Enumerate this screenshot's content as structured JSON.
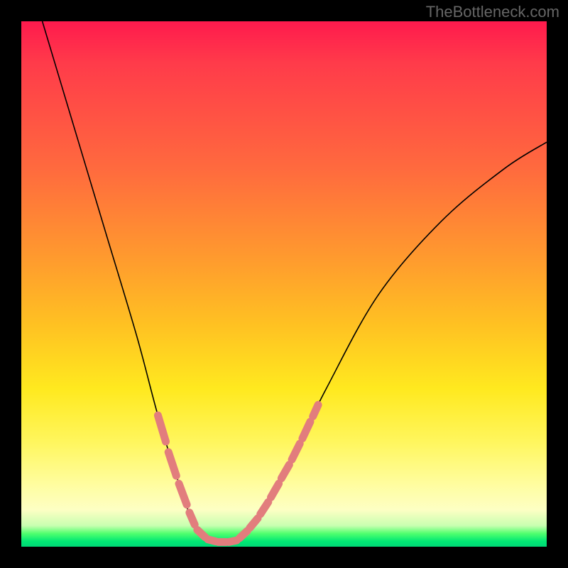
{
  "watermark": "TheBottleneck.com",
  "chart_data": {
    "type": "line",
    "title": "",
    "xlabel": "",
    "ylabel": "",
    "xlim": [
      0,
      100
    ],
    "ylim": [
      0,
      100
    ],
    "curve": {
      "name": "bottleneck-curve",
      "points": [
        {
          "x": 4,
          "y": 100
        },
        {
          "x": 10,
          "y": 80
        },
        {
          "x": 16,
          "y": 60
        },
        {
          "x": 22,
          "y": 40
        },
        {
          "x": 26,
          "y": 25
        },
        {
          "x": 30,
          "y": 12
        },
        {
          "x": 33,
          "y": 4
        },
        {
          "x": 36,
          "y": 1
        },
        {
          "x": 40,
          "y": 1
        },
        {
          "x": 44,
          "y": 4
        },
        {
          "x": 50,
          "y": 14
        },
        {
          "x": 58,
          "y": 30
        },
        {
          "x": 68,
          "y": 48
        },
        {
          "x": 80,
          "y": 62
        },
        {
          "x": 92,
          "y": 72
        },
        {
          "x": 100,
          "y": 77
        }
      ]
    },
    "highlight_segments": [
      {
        "x0": 26,
        "y0": 25,
        "x1": 27.5,
        "y1": 20
      },
      {
        "x0": 28,
        "y0": 18,
        "x1": 29.5,
        "y1": 13.5
      },
      {
        "x0": 30,
        "y0": 12,
        "x1": 31.5,
        "y1": 8
      },
      {
        "x0": 32,
        "y0": 6.5,
        "x1": 33,
        "y1": 4.2
      },
      {
        "x0": 33.5,
        "y0": 3.2,
        "x1": 35,
        "y1": 1.8
      },
      {
        "x0": 35.5,
        "y0": 1.4,
        "x1": 37,
        "y1": 1
      },
      {
        "x0": 37.5,
        "y0": 0.9,
        "x1": 39,
        "y1": 0.9
      },
      {
        "x0": 39.5,
        "y0": 0.9,
        "x1": 41,
        "y1": 1.2
      },
      {
        "x0": 41.5,
        "y0": 1.6,
        "x1": 43,
        "y1": 3
      },
      {
        "x0": 43.5,
        "y0": 3.6,
        "x1": 45,
        "y1": 5.4
      },
      {
        "x0": 45.5,
        "y0": 6.2,
        "x1": 47,
        "y1": 8.5
      },
      {
        "x0": 47.5,
        "y0": 9.4,
        "x1": 49,
        "y1": 12
      },
      {
        "x0": 49.5,
        "y0": 13,
        "x1": 51,
        "y1": 15.6
      },
      {
        "x0": 51.5,
        "y0": 16.6,
        "x1": 53,
        "y1": 19.6
      },
      {
        "x0": 53.5,
        "y0": 20.6,
        "x1": 55,
        "y1": 23.8
      },
      {
        "x0": 55.5,
        "y0": 24.8,
        "x1": 56.5,
        "y1": 27
      }
    ],
    "colors": {
      "curve_stroke": "#000000",
      "highlight_stroke": "#e27d7d",
      "gradient_top": "#ff1a4d",
      "gradient_bottom": "#00d876"
    }
  }
}
